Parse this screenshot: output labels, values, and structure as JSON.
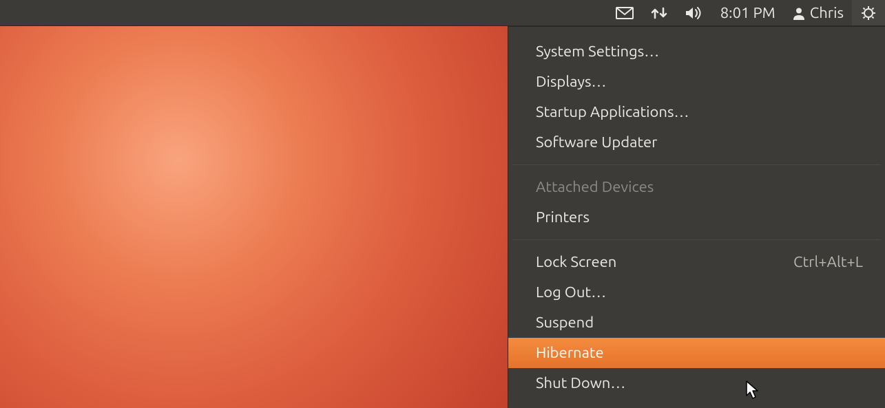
{
  "panel": {
    "time": "8:01 PM",
    "user": "Chris"
  },
  "menu": {
    "group1": [
      "System Settings…",
      "Displays…",
      "Startup Applications…",
      "Software Updater"
    ],
    "devices_header": "Attached Devices",
    "printers": "Printers",
    "lock": {
      "label": "Lock Screen",
      "shortcut": "Ctrl+Alt+L"
    },
    "logout": "Log Out…",
    "suspend": "Suspend",
    "hibernate": "Hibernate",
    "shutdown": "Shut Down…"
  }
}
